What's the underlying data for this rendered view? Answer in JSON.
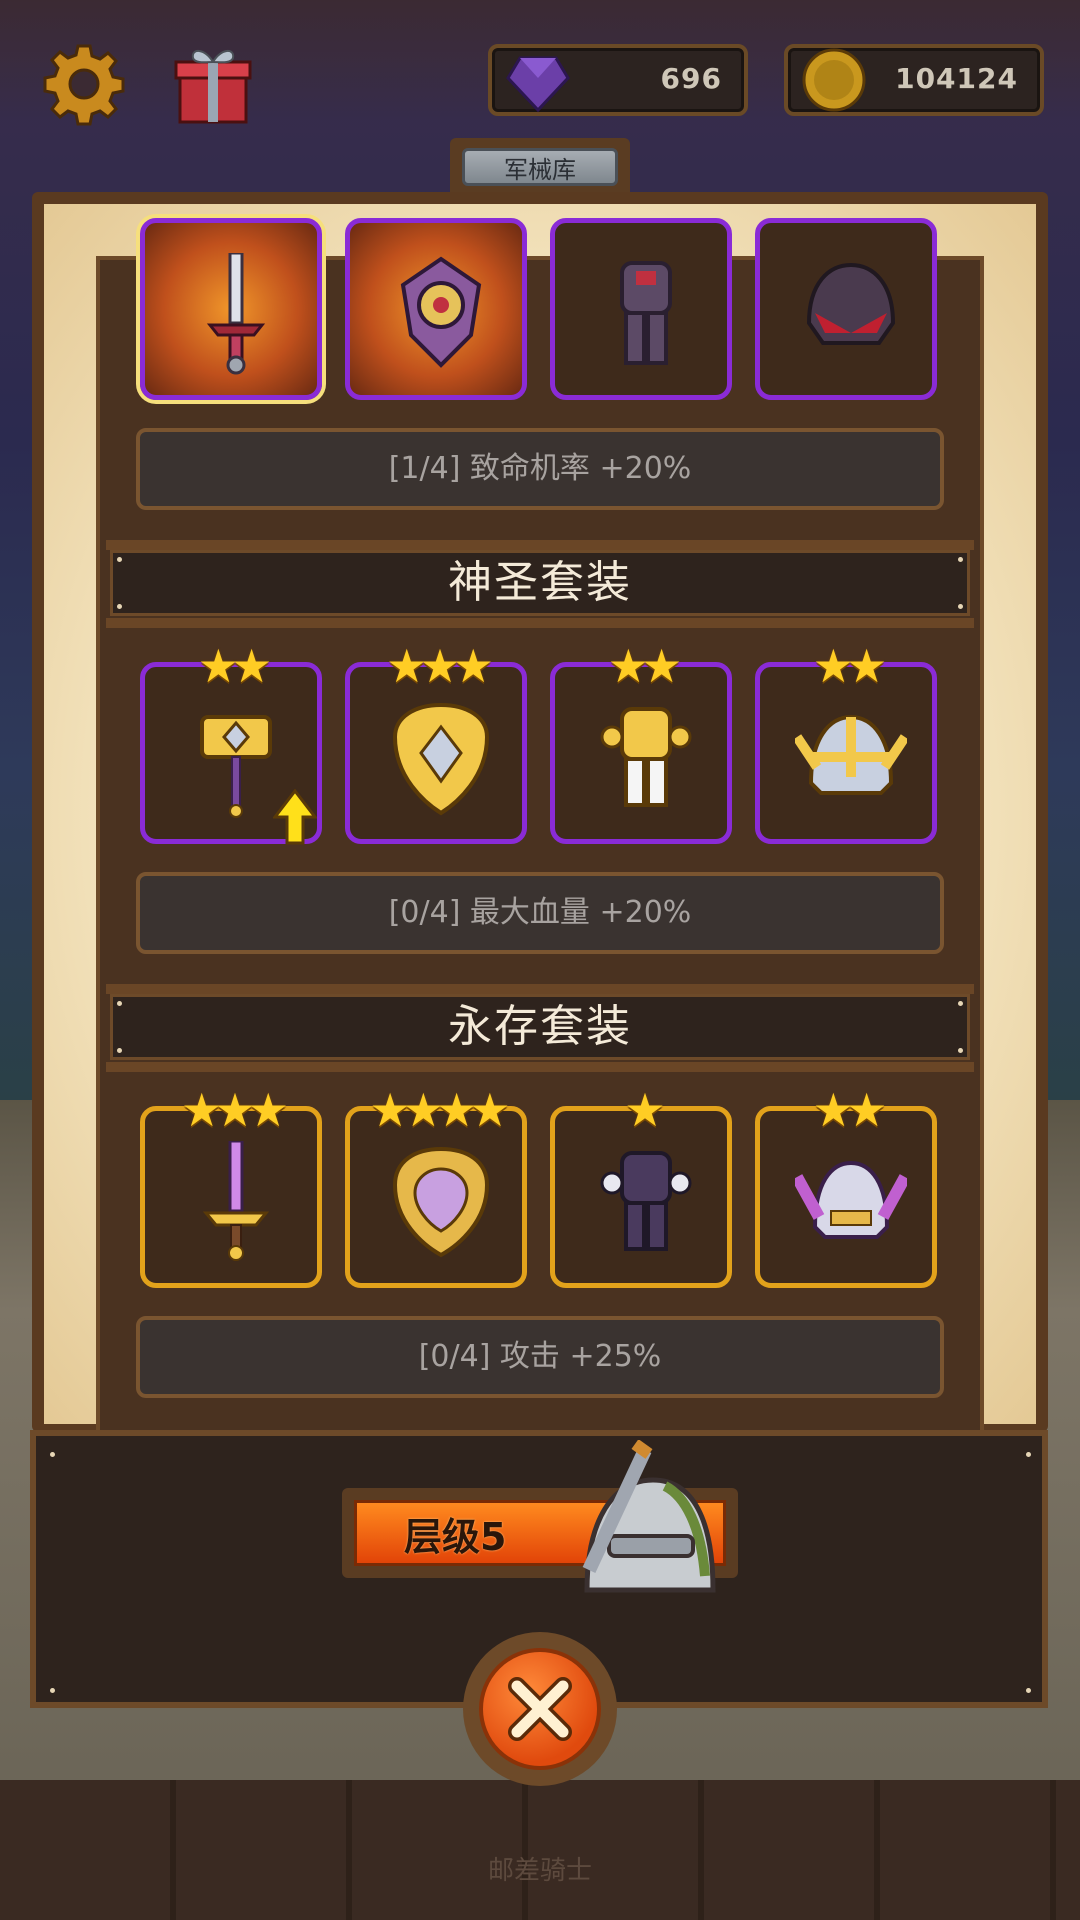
{
  "header": {
    "gems": "696",
    "coins": "104124",
    "tab_label": "军械库"
  },
  "sets": [
    {
      "name": "",
      "bonus": "[1/4] 致命机率 +20%",
      "items": [
        {
          "icon": "sword-icon",
          "stars": "",
          "frame": "purple",
          "glow": true,
          "selected": true
        },
        {
          "icon": "shield-icon",
          "stars": "",
          "frame": "purple",
          "glow": true
        },
        {
          "icon": "armor-icon",
          "stars": "",
          "frame": "purple"
        },
        {
          "icon": "helmet-icon",
          "stars": "",
          "frame": "purple"
        }
      ]
    },
    {
      "name": "神圣套装",
      "bonus": "[0/4] 最大血量 +20%",
      "items": [
        {
          "icon": "hammer-icon",
          "stars": "★★",
          "frame": "purple",
          "upgrade": true
        },
        {
          "icon": "shield-icon",
          "stars": "★★★",
          "frame": "purple"
        },
        {
          "icon": "armor-icon",
          "stars": "★★",
          "frame": "purple"
        },
        {
          "icon": "helmet-icon",
          "stars": "★★",
          "frame": "purple"
        }
      ]
    },
    {
      "name": "永存套装",
      "bonus": "[0/4] 攻击 +25%",
      "items": [
        {
          "icon": "sword-icon",
          "stars": "★★★",
          "frame": "gold"
        },
        {
          "icon": "shield-icon",
          "stars": "★★★★",
          "frame": "gold"
        },
        {
          "icon": "armor-icon",
          "stars": "★",
          "frame": "gold"
        },
        {
          "icon": "helmet-icon",
          "stars": "★★",
          "frame": "gold"
        }
      ]
    }
  ],
  "level": {
    "label": "层级5"
  },
  "footer": {
    "text": "邮差骑士"
  },
  "colors": {
    "purple_frame": "#8a2bd6",
    "gold_frame": "#e2a21b",
    "star": "#ffcd24",
    "accent_orange": "#e24408"
  }
}
